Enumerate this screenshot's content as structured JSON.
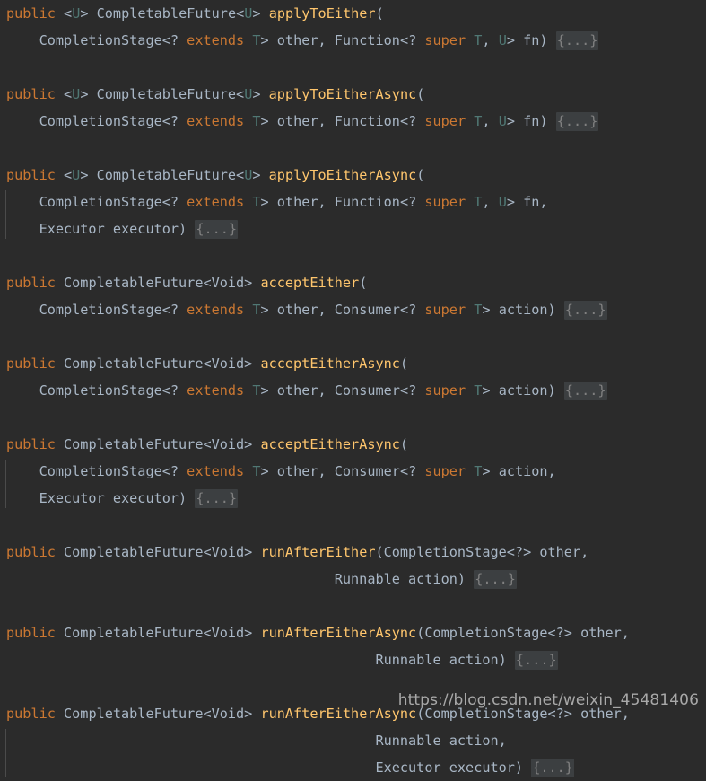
{
  "editor": {
    "theme_name": "darcula",
    "background_color": "#2b2b2b",
    "colors": {
      "keyword": "#cc7832",
      "identifier": "#a9b7c6",
      "type_parameter": "#507874",
      "method_name": "#ffc66d",
      "fold_text": "#808080",
      "fold_background": "#3c3f41",
      "indent_guide": "#4b4b4b"
    },
    "fold_placeholder": "{...}"
  },
  "watermark": {
    "text": "https://blog.csdn.net/weixin_45481406"
  },
  "lines": [
    {
      "id": "l1",
      "indent_guide": false,
      "tokens": [
        {
          "t": "public",
          "c": "kw"
        },
        {
          "t": " ",
          "c": "typ"
        },
        {
          "t": "<",
          "c": "typ"
        },
        {
          "t": "U",
          "c": "gen"
        },
        {
          "t": "> ",
          "c": "typ"
        },
        {
          "t": "CompletableFuture<",
          "c": "typ"
        },
        {
          "t": "U",
          "c": "gen"
        },
        {
          "t": "> ",
          "c": "typ"
        },
        {
          "t": "applyToEither",
          "c": "mth"
        },
        {
          "t": "(",
          "c": "typ"
        }
      ]
    },
    {
      "id": "l2",
      "indent_guide": false,
      "tokens": [
        {
          "t": "    CompletionStage<? ",
          "c": "typ"
        },
        {
          "t": "extends",
          "c": "kw"
        },
        {
          "t": " ",
          "c": "typ"
        },
        {
          "t": "T",
          "c": "gen"
        },
        {
          "t": "> other, Function<? ",
          "c": "typ"
        },
        {
          "t": "super",
          "c": "kw"
        },
        {
          "t": " ",
          "c": "typ"
        },
        {
          "t": "T",
          "c": "gen"
        },
        {
          "t": ", ",
          "c": "typ"
        },
        {
          "t": "U",
          "c": "gen"
        },
        {
          "t": "> fn) ",
          "c": "typ"
        },
        {
          "t": "{...}",
          "c": "fold"
        }
      ]
    },
    {
      "id": "b1",
      "blank": true,
      "indent_guide": false,
      "tokens": []
    },
    {
      "id": "l3",
      "indent_guide": false,
      "tokens": [
        {
          "t": "public",
          "c": "kw"
        },
        {
          "t": " <",
          "c": "typ"
        },
        {
          "t": "U",
          "c": "gen"
        },
        {
          "t": "> CompletableFuture<",
          "c": "typ"
        },
        {
          "t": "U",
          "c": "gen"
        },
        {
          "t": "> ",
          "c": "typ"
        },
        {
          "t": "applyToEitherAsync",
          "c": "mth"
        },
        {
          "t": "(",
          "c": "typ"
        }
      ]
    },
    {
      "id": "l4",
      "indent_guide": false,
      "tokens": [
        {
          "t": "    CompletionStage<? ",
          "c": "typ"
        },
        {
          "t": "extends",
          "c": "kw"
        },
        {
          "t": " ",
          "c": "typ"
        },
        {
          "t": "T",
          "c": "gen"
        },
        {
          "t": "> other, Function<? ",
          "c": "typ"
        },
        {
          "t": "super",
          "c": "kw"
        },
        {
          "t": " ",
          "c": "typ"
        },
        {
          "t": "T",
          "c": "gen"
        },
        {
          "t": ", ",
          "c": "typ"
        },
        {
          "t": "U",
          "c": "gen"
        },
        {
          "t": "> fn) ",
          "c": "typ"
        },
        {
          "t": "{...}",
          "c": "fold"
        }
      ]
    },
    {
      "id": "b2",
      "blank": true,
      "indent_guide": false,
      "tokens": []
    },
    {
      "id": "l5",
      "indent_guide": false,
      "tokens": [
        {
          "t": "public",
          "c": "kw"
        },
        {
          "t": " <",
          "c": "typ"
        },
        {
          "t": "U",
          "c": "gen"
        },
        {
          "t": "> CompletableFuture<",
          "c": "typ"
        },
        {
          "t": "U",
          "c": "gen"
        },
        {
          "t": "> ",
          "c": "typ"
        },
        {
          "t": "applyToEitherAsync",
          "c": "mth"
        },
        {
          "t": "(",
          "c": "typ"
        }
      ]
    },
    {
      "id": "l6",
      "indent_guide": true,
      "tokens": [
        {
          "t": "    CompletionStage<? ",
          "c": "typ"
        },
        {
          "t": "extends",
          "c": "kw"
        },
        {
          "t": " ",
          "c": "typ"
        },
        {
          "t": "T",
          "c": "gen"
        },
        {
          "t": "> other, Function<? ",
          "c": "typ"
        },
        {
          "t": "super",
          "c": "kw"
        },
        {
          "t": " ",
          "c": "typ"
        },
        {
          "t": "T",
          "c": "gen"
        },
        {
          "t": ", ",
          "c": "typ"
        },
        {
          "t": "U",
          "c": "gen"
        },
        {
          "t": "> fn,",
          "c": "typ"
        }
      ]
    },
    {
      "id": "l7",
      "indent_guide": true,
      "tokens": [
        {
          "t": "    Executor executor) ",
          "c": "typ"
        },
        {
          "t": "{...}",
          "c": "fold"
        }
      ]
    },
    {
      "id": "b3",
      "blank": true,
      "indent_guide": false,
      "tokens": []
    },
    {
      "id": "l8",
      "indent_guide": false,
      "tokens": [
        {
          "t": "public",
          "c": "kw"
        },
        {
          "t": " CompletableFuture<Void> ",
          "c": "typ"
        },
        {
          "t": "acceptEither",
          "c": "mth"
        },
        {
          "t": "(",
          "c": "typ"
        }
      ]
    },
    {
      "id": "l9",
      "indent_guide": false,
      "tokens": [
        {
          "t": "    CompletionStage<? ",
          "c": "typ"
        },
        {
          "t": "extends",
          "c": "kw"
        },
        {
          "t": " ",
          "c": "typ"
        },
        {
          "t": "T",
          "c": "gen"
        },
        {
          "t": "> other, Consumer<? ",
          "c": "typ"
        },
        {
          "t": "super",
          "c": "kw"
        },
        {
          "t": " ",
          "c": "typ"
        },
        {
          "t": "T",
          "c": "gen"
        },
        {
          "t": "> action) ",
          "c": "typ"
        },
        {
          "t": "{...}",
          "c": "fold"
        }
      ]
    },
    {
      "id": "b4",
      "blank": true,
      "indent_guide": false,
      "tokens": []
    },
    {
      "id": "l10",
      "indent_guide": false,
      "tokens": [
        {
          "t": "public",
          "c": "kw"
        },
        {
          "t": " CompletableFuture<Void> ",
          "c": "typ"
        },
        {
          "t": "acceptEitherAsync",
          "c": "mth"
        },
        {
          "t": "(",
          "c": "typ"
        }
      ]
    },
    {
      "id": "l11",
      "indent_guide": false,
      "tokens": [
        {
          "t": "    CompletionStage<? ",
          "c": "typ"
        },
        {
          "t": "extends",
          "c": "kw"
        },
        {
          "t": " ",
          "c": "typ"
        },
        {
          "t": "T",
          "c": "gen"
        },
        {
          "t": "> other, Consumer<? ",
          "c": "typ"
        },
        {
          "t": "super",
          "c": "kw"
        },
        {
          "t": " ",
          "c": "typ"
        },
        {
          "t": "T",
          "c": "gen"
        },
        {
          "t": "> action) ",
          "c": "typ"
        },
        {
          "t": "{...}",
          "c": "fold"
        }
      ]
    },
    {
      "id": "b5",
      "blank": true,
      "indent_guide": false,
      "tokens": []
    },
    {
      "id": "l12",
      "indent_guide": false,
      "tokens": [
        {
          "t": "public",
          "c": "kw"
        },
        {
          "t": " CompletableFuture<Void> ",
          "c": "typ"
        },
        {
          "t": "acceptEitherAsync",
          "c": "mth"
        },
        {
          "t": "(",
          "c": "typ"
        }
      ]
    },
    {
      "id": "l13",
      "indent_guide": true,
      "tokens": [
        {
          "t": "    CompletionStage<? ",
          "c": "typ"
        },
        {
          "t": "extends",
          "c": "kw"
        },
        {
          "t": " ",
          "c": "typ"
        },
        {
          "t": "T",
          "c": "gen"
        },
        {
          "t": "> other, Consumer<? ",
          "c": "typ"
        },
        {
          "t": "super",
          "c": "kw"
        },
        {
          "t": " ",
          "c": "typ"
        },
        {
          "t": "T",
          "c": "gen"
        },
        {
          "t": "> action,",
          "c": "typ"
        }
      ]
    },
    {
      "id": "l14",
      "indent_guide": true,
      "tokens": [
        {
          "t": "    Executor executor) ",
          "c": "typ"
        },
        {
          "t": "{...}",
          "c": "fold"
        }
      ]
    },
    {
      "id": "b6",
      "blank": true,
      "indent_guide": false,
      "tokens": []
    },
    {
      "id": "l15",
      "indent_guide": false,
      "tokens": [
        {
          "t": "public",
          "c": "kw"
        },
        {
          "t": " CompletableFuture<Void> ",
          "c": "typ"
        },
        {
          "t": "runAfterEither",
          "c": "mth"
        },
        {
          "t": "(CompletionStage<?> other,",
          "c": "typ"
        }
      ]
    },
    {
      "id": "l16",
      "indent_guide": false,
      "tokens": [
        {
          "t": "                                        Runnable action) ",
          "c": "typ"
        },
        {
          "t": "{...}",
          "c": "fold"
        }
      ]
    },
    {
      "id": "b7",
      "blank": true,
      "indent_guide": false,
      "tokens": []
    },
    {
      "id": "l17",
      "indent_guide": false,
      "tokens": [
        {
          "t": "public",
          "c": "kw"
        },
        {
          "t": " CompletableFuture<Void> ",
          "c": "typ"
        },
        {
          "t": "runAfterEitherAsync",
          "c": "mth"
        },
        {
          "t": "(CompletionStage<?> other,",
          "c": "typ"
        }
      ]
    },
    {
      "id": "l18",
      "indent_guide": false,
      "tokens": [
        {
          "t": "                                             Runnable action) ",
          "c": "typ"
        },
        {
          "t": "{...}",
          "c": "fold"
        }
      ]
    },
    {
      "id": "b8",
      "blank": true,
      "indent_guide": false,
      "tokens": []
    },
    {
      "id": "l19",
      "indent_guide": false,
      "tokens": [
        {
          "t": "public",
          "c": "kw"
        },
        {
          "t": " CompletableFuture<Void> ",
          "c": "typ"
        },
        {
          "t": "runAfterEitherAsync",
          "c": "mth"
        },
        {
          "t": "(CompletionStage<?> other,",
          "c": "typ"
        }
      ]
    },
    {
      "id": "l20",
      "indent_guide": true,
      "tokens": [
        {
          "t": "                                             Runnable action,",
          "c": "typ"
        }
      ]
    },
    {
      "id": "l21",
      "indent_guide": true,
      "tokens": [
        {
          "t": "                                             Executor executor) ",
          "c": "typ"
        },
        {
          "t": "{...}",
          "c": "fold"
        }
      ]
    }
  ]
}
